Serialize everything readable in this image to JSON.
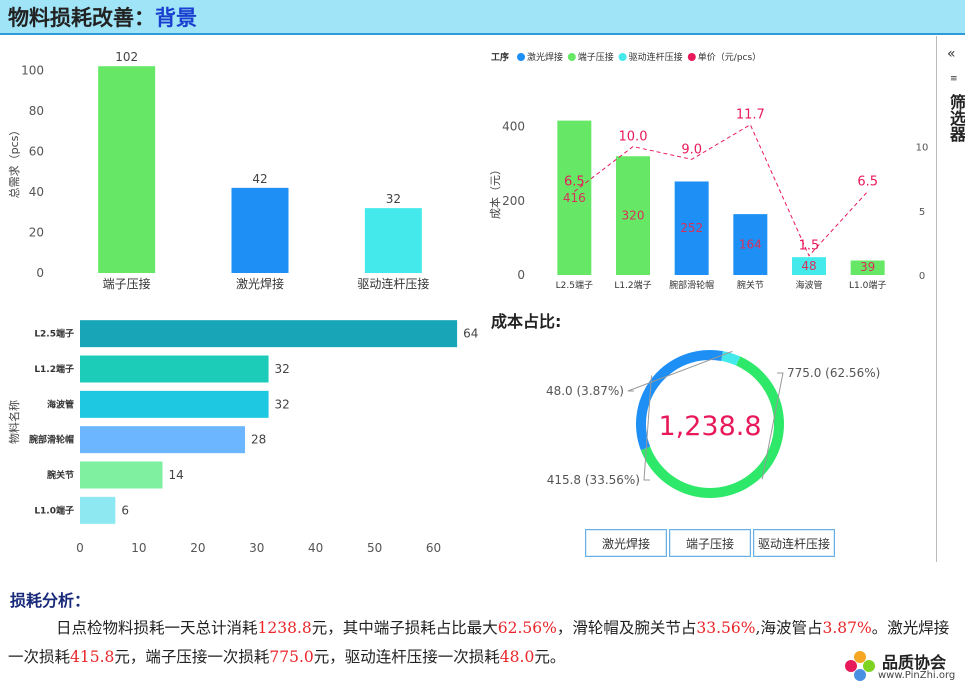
{
  "header": {
    "title_prefix": "物料损耗改善：",
    "title_suffix": "背景"
  },
  "sidebar": {
    "label": "筛选器",
    "collapse_glyph": "«"
  },
  "colors": {
    "green": "#66e866",
    "blue": "#1e8ff5",
    "cyan": "#44e9ec",
    "teal": "#18a5b8",
    "red": "#e8195a"
  },
  "chart_data": [
    {
      "id": "demand",
      "type": "bar",
      "categories": [
        "端子压接",
        "激光焊接",
        "驱动连杆压接"
      ],
      "values": [
        102,
        42,
        32
      ],
      "ylabel": "总需求（pcs）",
      "ylim": [
        0,
        110
      ],
      "yticks": [
        0,
        20,
        40,
        60,
        80,
        100
      ],
      "colors": [
        "#66e866",
        "#1e8ff5",
        "#44e9ec"
      ]
    },
    {
      "id": "cost",
      "type": "bar",
      "legend_title": "工序",
      "legend": [
        {
          "name": "激光焊接",
          "color": "#1e8ff5"
        },
        {
          "name": "端子压接",
          "color": "#66e866"
        },
        {
          "name": "驱动连杆压接",
          "color": "#44e9ec"
        },
        {
          "name": "单价（元/pcs）",
          "color": "#e8195a"
        }
      ],
      "categories": [
        "L2.5端子",
        "L1.2端子",
        "腕部滑轮帽",
        "腕关节",
        "海波管",
        "L1.0端子"
      ],
      "series": [
        {
          "name": "成本（元）",
          "values": [
            416,
            320,
            252,
            164,
            48,
            39
          ],
          "colors": [
            "#66e866",
            "#66e866",
            "#1e8ff5",
            "#1e8ff5",
            "#44e9ec",
            "#66e866"
          ]
        },
        {
          "name": "单价（元/pcs）",
          "type": "line",
          "values": [
            6.5,
            10.0,
            9.0,
            11.7,
            1.5,
            6.5
          ]
        }
      ],
      "value_labels": [
        "416",
        "320",
        "252",
        "164",
        "48",
        "39"
      ],
      "price_labels": [
        "6.5",
        "10.0",
        "9.0",
        "11.7",
        "1.5",
        "6.5"
      ],
      "ylabel": "成本（元）",
      "ylim": [
        0,
        450
      ],
      "yticks": [
        0,
        200,
        400
      ],
      "y2lim": [
        0,
        13
      ],
      "y2ticks": [
        0,
        5,
        10
      ]
    },
    {
      "id": "material",
      "type": "bar",
      "orientation": "horizontal",
      "categories": [
        "L2.5端子",
        "L1.2端子",
        "海波管",
        "腕部滑轮帽",
        "腕关节",
        "L1.0端子"
      ],
      "values": [
        64,
        32,
        32,
        28,
        14,
        6
      ],
      "ylabel": "物料名称",
      "xlim": [
        0,
        65
      ],
      "xticks": [
        0,
        10,
        20,
        30,
        40,
        50,
        60
      ],
      "colors": [
        "#18a5b8",
        "#1dccb8",
        "#1ec8e0",
        "#6cb5ff",
        "#7ef0a0",
        "#8ee8f2"
      ]
    },
    {
      "id": "share",
      "type": "pie",
      "title": "成本占比:",
      "total_label": "1,238.8",
      "slices": [
        {
          "name": "端子压接",
          "value": 775.0,
          "label": "775.0 (62.56%)",
          "color": "#2ee86a"
        },
        {
          "name": "激光焊接",
          "value": 415.8,
          "label": "415.8 (33.56%)",
          "color": "#1e8ff5"
        },
        {
          "name": "驱动连杆压接",
          "value": 48.0,
          "label": "48.0 (3.87%)",
          "color": "#44e9ec"
        }
      ]
    }
  ],
  "filter_buttons": [
    {
      "label": "激光焊接"
    },
    {
      "label": "端子压接"
    },
    {
      "label": "驱动连杆压接"
    }
  ],
  "analysis": {
    "title": "损耗分析：",
    "p1": "日点检物料损耗一天总计消耗",
    "v_total": "1238.8",
    "p2": "元，其中端子损耗占比最大",
    "v_term": "62.56%",
    "p3": "，滑轮帽及腕关节占",
    "v_pulley": "33.56%",
    "p4": ",海波管占",
    "v_tube": "3.87%",
    "p5": "。激光焊接一次损耗",
    "v_laser": "415.8",
    "p6": "元，端子压接一次损耗",
    "v_crimp": "775.0",
    "p7": "元，驱动连杆压接一次损耗",
    "v_link": "48.0",
    "p8": "元。"
  },
  "logo": {
    "name": "品质协会",
    "url": "www.PinZhi.org"
  }
}
